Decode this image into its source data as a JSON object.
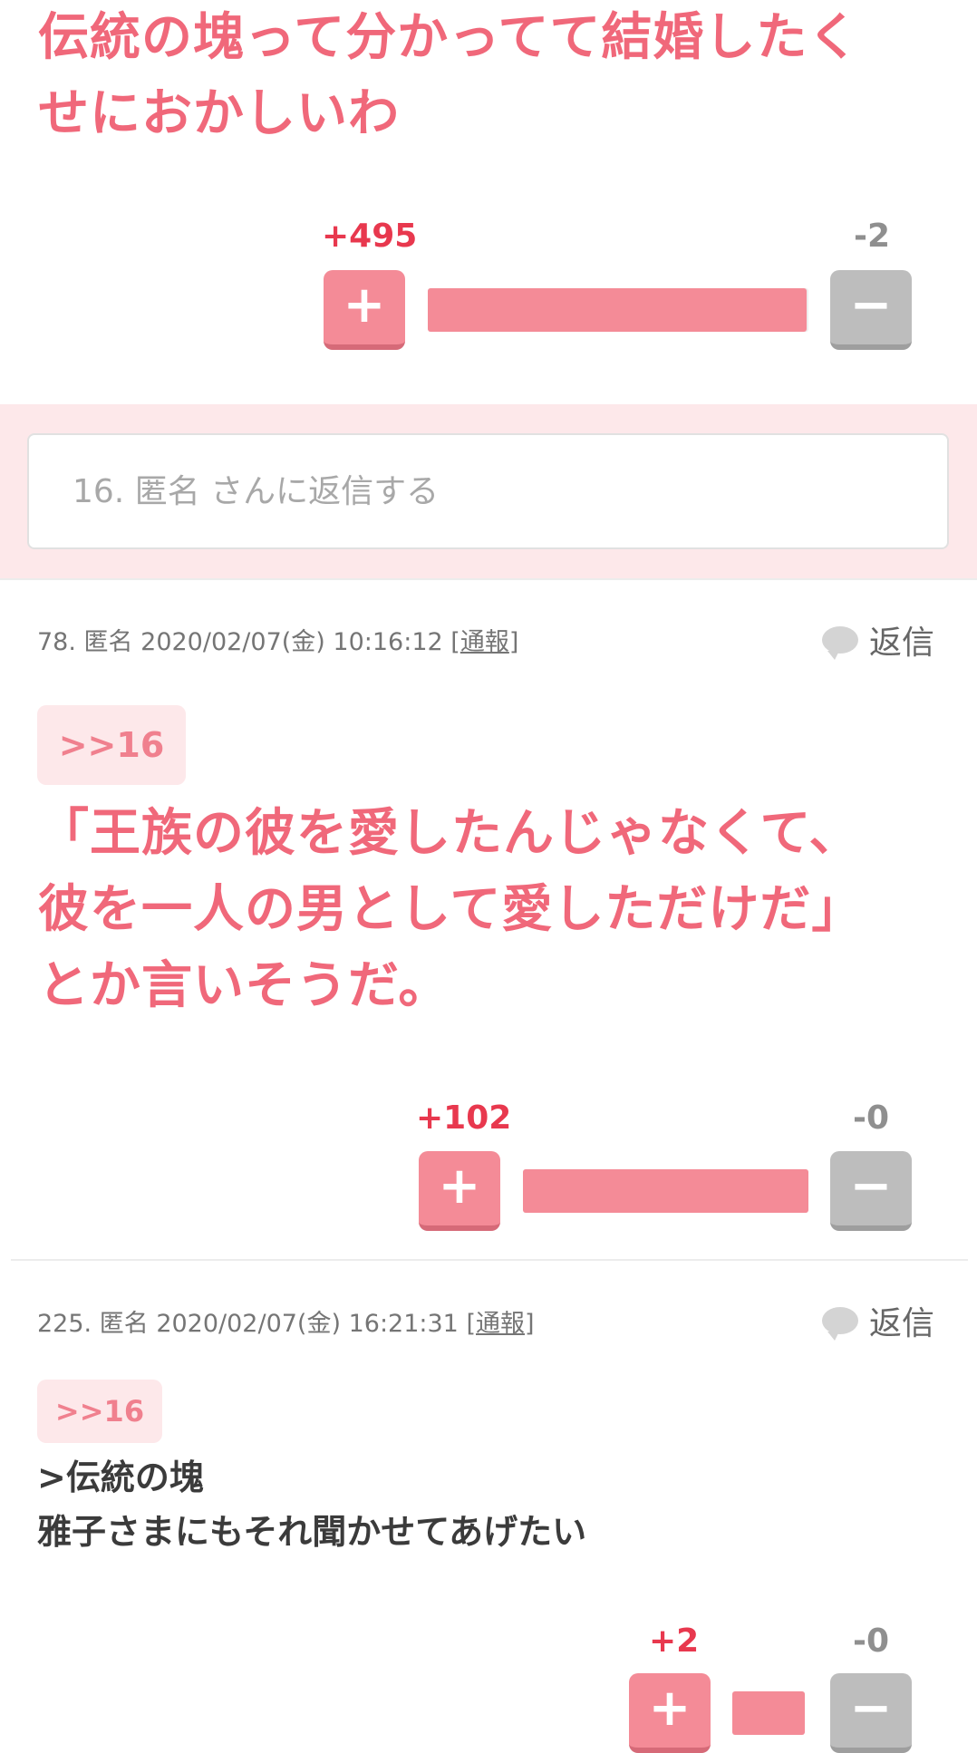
{
  "comment_16": {
    "body_lines": [
      "伝統の塊って分かってて結婚したく",
      "せにおかしいわ"
    ],
    "plus_score": "+495",
    "minus_score": "-2",
    "plus_ratio": 0.996
  },
  "reply_box": {
    "placeholder": "16. 匿名 さんに返信する"
  },
  "comment_78": {
    "number": "78.",
    "author": "匿名",
    "timestamp": "2020/02/07(金) 10:16:12",
    "report_label": "通報",
    "reply_label": "返信",
    "anchor": ">>16",
    "body_lines": [
      "「王族の彼を愛したんじゃなくて、",
      "彼を一人の男として愛しただけだ」",
      "とか言いそうだ。"
    ],
    "plus_score": "+102",
    "minus_score": "-0",
    "plus_ratio": 1.0
  },
  "comment_225": {
    "number": "225.",
    "author": "匿名",
    "timestamp": "2020/02/07(金) 16:21:31",
    "report_label": "通報",
    "reply_label": "返信",
    "anchor": ">>16",
    "body_lines": [
      ">伝統の塊",
      "雅子さまにもそれ聞かせてあげたい"
    ],
    "plus_score": "+2",
    "minus_score": "-0",
    "plus_ratio": 1.0
  },
  "icons": {
    "plus": "+",
    "minus": "−",
    "reply": "speech-bubble-icon"
  },
  "colors": {
    "accent_pink": "#f0687a",
    "plus_red": "#e8384e",
    "bar_pink": "#f48b97",
    "minus_gray": "#bdbdbd",
    "band_pink": "#fde8ea"
  }
}
